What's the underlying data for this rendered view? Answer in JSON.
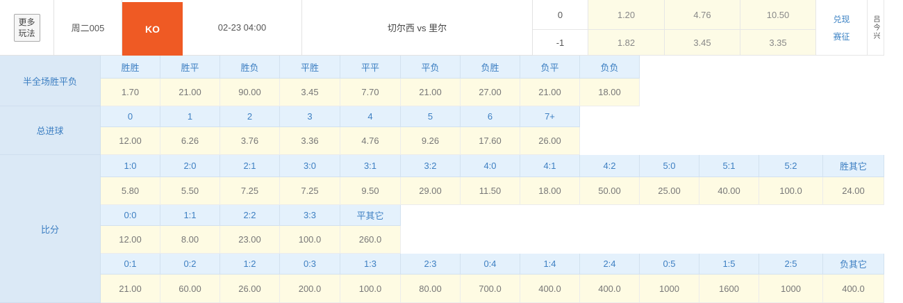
{
  "header": {
    "more_play_label": "更多玩法",
    "match_no": "周二005",
    "league_logo_text": "KO",
    "datetime": "02-23 04:00",
    "teams": "切尔西 vs 里尔",
    "handicap_top": "0",
    "handicap_bottom": "-1",
    "odds_top": [
      "1.20",
      "4.76",
      "10.50"
    ],
    "odds_bottom": [
      "1.82",
      "3.45",
      "3.35"
    ],
    "links": [
      "兑现",
      "赛征"
    ],
    "extra_label": "吕今兴",
    "colors": {
      "logo_bg": "#ef5a24",
      "header_blue": "#3d7fc2",
      "odds_bg": "#fdfbe6"
    }
  },
  "htft": {
    "label": "半全场胜平负",
    "headers": [
      "胜胜",
      "胜平",
      "胜负",
      "平胜",
      "平平",
      "平负",
      "负胜",
      "负平",
      "负负"
    ],
    "values": [
      "1.70",
      "21.00",
      "90.00",
      "3.45",
      "7.70",
      "21.00",
      "27.00",
      "21.00",
      "18.00"
    ]
  },
  "goals": {
    "label": "总进球",
    "headers": [
      "0",
      "1",
      "2",
      "3",
      "4",
      "5",
      "6",
      "7+"
    ],
    "values": [
      "12.00",
      "6.26",
      "3.76",
      "3.36",
      "4.76",
      "9.26",
      "17.60",
      "26.00"
    ]
  },
  "score": {
    "label": "比分",
    "home_headers": [
      "1:0",
      "2:0",
      "2:1",
      "3:0",
      "3:1",
      "3:2",
      "4:0",
      "4:1",
      "4:2",
      "5:0",
      "5:1",
      "5:2",
      "胜其它"
    ],
    "home_values": [
      "5.80",
      "5.50",
      "7.25",
      "7.25",
      "9.50",
      "29.00",
      "11.50",
      "18.00",
      "50.00",
      "25.00",
      "40.00",
      "100.0",
      "24.00"
    ],
    "draw_headers": [
      "0:0",
      "1:1",
      "2:2",
      "3:3",
      "平其它"
    ],
    "draw_values": [
      "12.00",
      "8.00",
      "23.00",
      "100.0",
      "260.0"
    ],
    "away_headers": [
      "0:1",
      "0:2",
      "1:2",
      "0:3",
      "1:3",
      "2:3",
      "0:4",
      "1:4",
      "2:4",
      "0:5",
      "1:5",
      "2:5",
      "负其它"
    ],
    "away_values": [
      "21.00",
      "60.00",
      "26.00",
      "200.0",
      "100.0",
      "80.00",
      "700.0",
      "400.0",
      "400.0",
      "1000",
      "1600",
      "1000",
      "400.0"
    ]
  }
}
